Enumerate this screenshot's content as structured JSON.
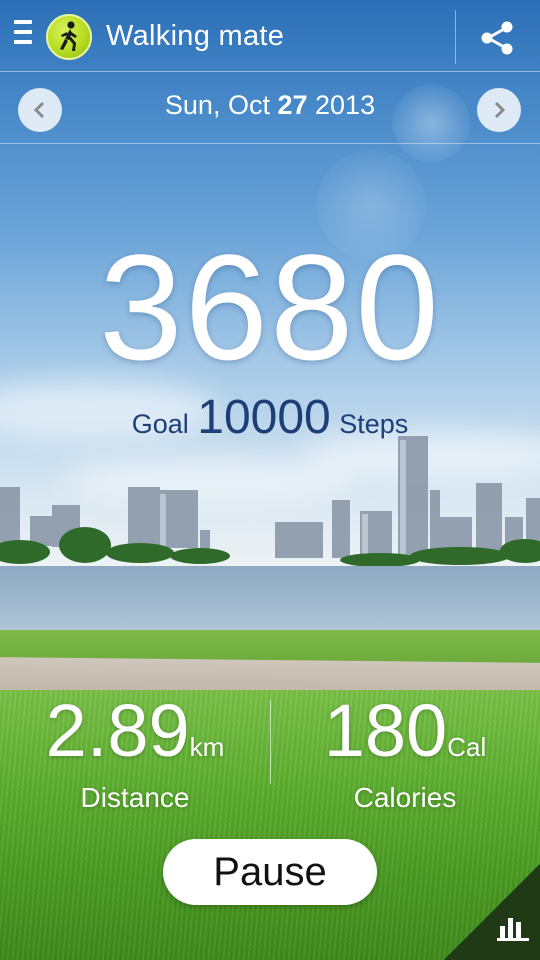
{
  "app": {
    "title": "Walking mate",
    "logo_icon": "walker-icon",
    "menu_icon": "menu-icon",
    "share_icon": "share-icon",
    "accent_color": "#b6dc22"
  },
  "date_bar": {
    "date_prefix": "Sun, Oct ",
    "date_day": "27",
    "date_suffix": " 2013",
    "prev_icon": "chevron-left-icon",
    "next_icon": "chevron-right-icon"
  },
  "counter": {
    "steps": "3680",
    "goal_label": "Goal",
    "goal_value": "10000",
    "goal_unit": "Steps",
    "goal_color": "#1d3f78"
  },
  "stats": {
    "distance": {
      "value": "2.89",
      "unit": "km",
      "label": "Distance"
    },
    "calories": {
      "value": "180",
      "unit": "Cal",
      "label": "Calories"
    }
  },
  "actions": {
    "pause_label": "Pause",
    "chart_icon": "bar-chart-icon"
  }
}
